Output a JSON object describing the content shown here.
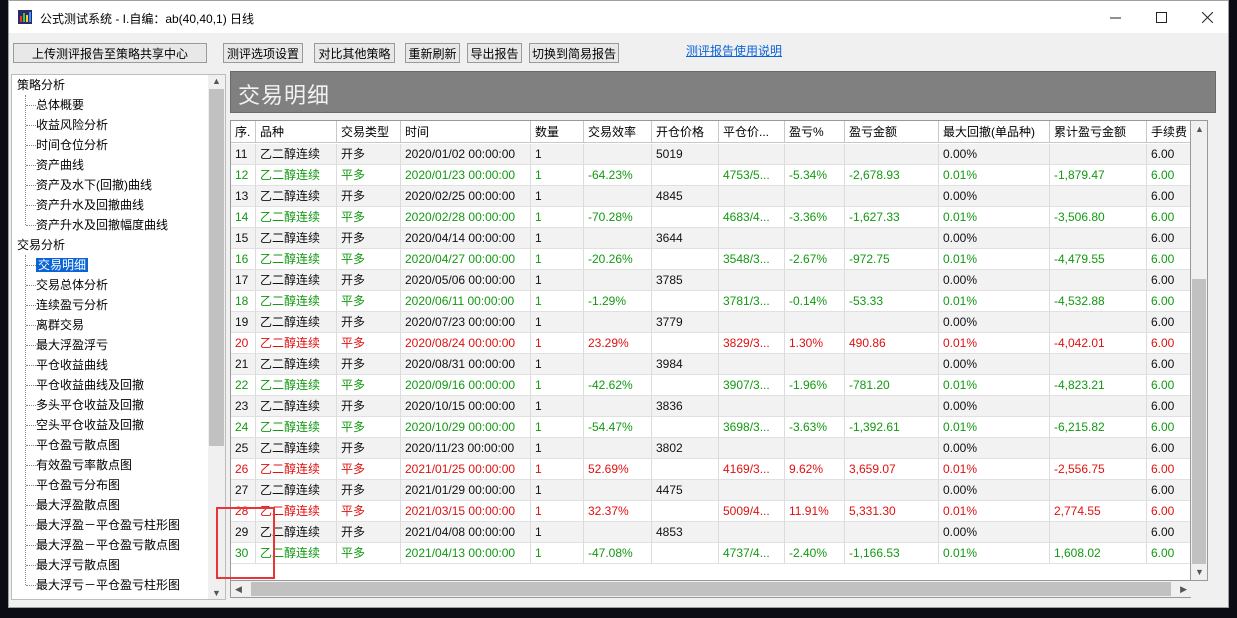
{
  "colors": {
    "accent": "#0a64d8",
    "gain": "#e01010",
    "loss": "#119911"
  },
  "window": {
    "title": "公式测试系统 - I.自编：ab(40,40,1) 日线"
  },
  "toolbar": {
    "upload": "上传测评报告至策略共享中心",
    "options": "测评选项设置",
    "compare": "对比其他策略",
    "refresh": "重新刷新",
    "export": "导出报告",
    "simple": "切换到简易报告",
    "help_link": "测评报告使用说明"
  },
  "tree": {
    "groups": [
      {
        "label": "策略分析",
        "items": [
          "总体概要",
          "收益风险分析",
          "时间仓位分析",
          "资产曲线",
          "资产及水下(回撤)曲线",
          "资产升水及回撤曲线",
          "资产升水及回撤幅度曲线"
        ]
      },
      {
        "label": "交易分析",
        "items": [
          "交易明细",
          "交易总体分析",
          "连续盈亏分析",
          "离群交易",
          "最大浮盈浮亏",
          "平仓收益曲线",
          "平仓收益曲线及回撤",
          "多头平仓收益及回撤",
          "空头平仓收益及回撤",
          "平仓盈亏散点图",
          "有效盈亏率散点图",
          "平仓盈亏分布图",
          "最大浮盈散点图",
          "最大浮盈－平仓盈亏柱形图",
          "最大浮盈－平仓盈亏散点图",
          "最大浮亏散点图",
          "最大浮亏－平仓盈亏柱形图"
        ]
      }
    ],
    "selected": "交易明细"
  },
  "banner": {
    "title": "交易明细"
  },
  "table": {
    "columns": [
      "序.",
      "品种",
      "交易类型",
      "时间",
      "数量",
      "交易效率",
      "开仓价格",
      "平仓价...",
      "盈亏%",
      "盈亏金额",
      "最大回撤(单品种)",
      "累计盈亏金额",
      "手续费"
    ],
    "rows": [
      {
        "tone": "black",
        "cells": [
          "11",
          "乙二醇连续",
          "开多",
          "2020/01/02 00:00:00",
          "1",
          "",
          "5019",
          "",
          "",
          "",
          "0.00%",
          "",
          "6.00"
        ]
      },
      {
        "tone": "green",
        "cells": [
          "12",
          "乙二醇连续",
          "平多",
          "2020/01/23 00:00:00",
          "1",
          "-64.23%",
          "",
          "4753/5...",
          "-5.34%",
          "-2,678.93",
          "0.01%",
          "-1,879.47",
          "6.00"
        ]
      },
      {
        "tone": "black",
        "cells": [
          "13",
          "乙二醇连续",
          "开多",
          "2020/02/25 00:00:00",
          "1",
          "",
          "4845",
          "",
          "",
          "",
          "0.00%",
          "",
          "6.00"
        ]
      },
      {
        "tone": "green",
        "cells": [
          "14",
          "乙二醇连续",
          "平多",
          "2020/02/28 00:00:00",
          "1",
          "-70.28%",
          "",
          "4683/4...",
          "-3.36%",
          "-1,627.33",
          "0.01%",
          "-3,506.80",
          "6.00"
        ]
      },
      {
        "tone": "black",
        "cells": [
          "15",
          "乙二醇连续",
          "开多",
          "2020/04/14 00:00:00",
          "1",
          "",
          "3644",
          "",
          "",
          "",
          "0.00%",
          "",
          "6.00"
        ]
      },
      {
        "tone": "green",
        "cells": [
          "16",
          "乙二醇连续",
          "平多",
          "2020/04/27 00:00:00",
          "1",
          "-20.26%",
          "",
          "3548/3...",
          "-2.67%",
          "-972.75",
          "0.01%",
          "-4,479.55",
          "6.00"
        ]
      },
      {
        "tone": "black",
        "cells": [
          "17",
          "乙二醇连续",
          "开多",
          "2020/05/06 00:00:00",
          "1",
          "",
          "3785",
          "",
          "",
          "",
          "0.00%",
          "",
          "6.00"
        ]
      },
      {
        "tone": "green",
        "cells": [
          "18",
          "乙二醇连续",
          "平多",
          "2020/06/11 00:00:00",
          "1",
          "-1.29%",
          "",
          "3781/3...",
          "-0.14%",
          "-53.33",
          "0.01%",
          "-4,532.88",
          "6.00"
        ]
      },
      {
        "tone": "black",
        "cells": [
          "19",
          "乙二醇连续",
          "开多",
          "2020/07/23 00:00:00",
          "1",
          "",
          "3779",
          "",
          "",
          "",
          "0.00%",
          "",
          "6.00"
        ]
      },
      {
        "tone": "red",
        "cells": [
          "20",
          "乙二醇连续",
          "平多",
          "2020/08/24 00:00:00",
          "1",
          "23.29%",
          "",
          "3829/3...",
          "1.30%",
          "490.86",
          "0.01%",
          "-4,042.01",
          "6.00"
        ]
      },
      {
        "tone": "black",
        "cells": [
          "21",
          "乙二醇连续",
          "开多",
          "2020/08/31 00:00:00",
          "1",
          "",
          "3984",
          "",
          "",
          "",
          "0.00%",
          "",
          "6.00"
        ]
      },
      {
        "tone": "green",
        "cells": [
          "22",
          "乙二醇连续",
          "平多",
          "2020/09/16 00:00:00",
          "1",
          "-42.62%",
          "",
          "3907/3...",
          "-1.96%",
          "-781.20",
          "0.01%",
          "-4,823.21",
          "6.00"
        ]
      },
      {
        "tone": "black",
        "cells": [
          "23",
          "乙二醇连续",
          "开多",
          "2020/10/15 00:00:00",
          "1",
          "",
          "3836",
          "",
          "",
          "",
          "0.00%",
          "",
          "6.00"
        ]
      },
      {
        "tone": "green",
        "cells": [
          "24",
          "乙二醇连续",
          "平多",
          "2020/10/29 00:00:00",
          "1",
          "-54.47%",
          "",
          "3698/3...",
          "-3.63%",
          "-1,392.61",
          "0.01%",
          "-6,215.82",
          "6.00"
        ]
      },
      {
        "tone": "black",
        "cells": [
          "25",
          "乙二醇连续",
          "开多",
          "2020/11/23 00:00:00",
          "1",
          "",
          "3802",
          "",
          "",
          "",
          "0.00%",
          "",
          "6.00"
        ]
      },
      {
        "tone": "red",
        "cells": [
          "26",
          "乙二醇连续",
          "平多",
          "2021/01/25 00:00:00",
          "1",
          "52.69%",
          "",
          "4169/3...",
          "9.62%",
          "3,659.07",
          "0.01%",
          "-2,556.75",
          "6.00"
        ]
      },
      {
        "tone": "black",
        "cells": [
          "27",
          "乙二醇连续",
          "开多",
          "2021/01/29 00:00:00",
          "1",
          "",
          "4475",
          "",
          "",
          "",
          "0.00%",
          "",
          "6.00"
        ]
      },
      {
        "tone": "red",
        "cells": [
          "28",
          "乙二醇连续",
          "平多",
          "2021/03/15 00:00:00",
          "1",
          "32.37%",
          "",
          "5009/4...",
          "11.91%",
          "5,331.30",
          "0.01%",
          "2,774.55",
          "6.00"
        ]
      },
      {
        "tone": "black",
        "cells": [
          "29",
          "乙二醇连续",
          "开多",
          "2021/04/08 00:00:00",
          "1",
          "",
          "4853",
          "",
          "",
          "",
          "0.00%",
          "",
          "6.00"
        ]
      },
      {
        "tone": "green",
        "cells": [
          "30",
          "乙二醇连续",
          "平多",
          "2021/04/13 00:00:00",
          "1",
          "-47.08%",
          "",
          "4737/4...",
          "-2.40%",
          "-1,166.53",
          "0.01%",
          "1,608.02",
          "6.00"
        ]
      }
    ]
  }
}
